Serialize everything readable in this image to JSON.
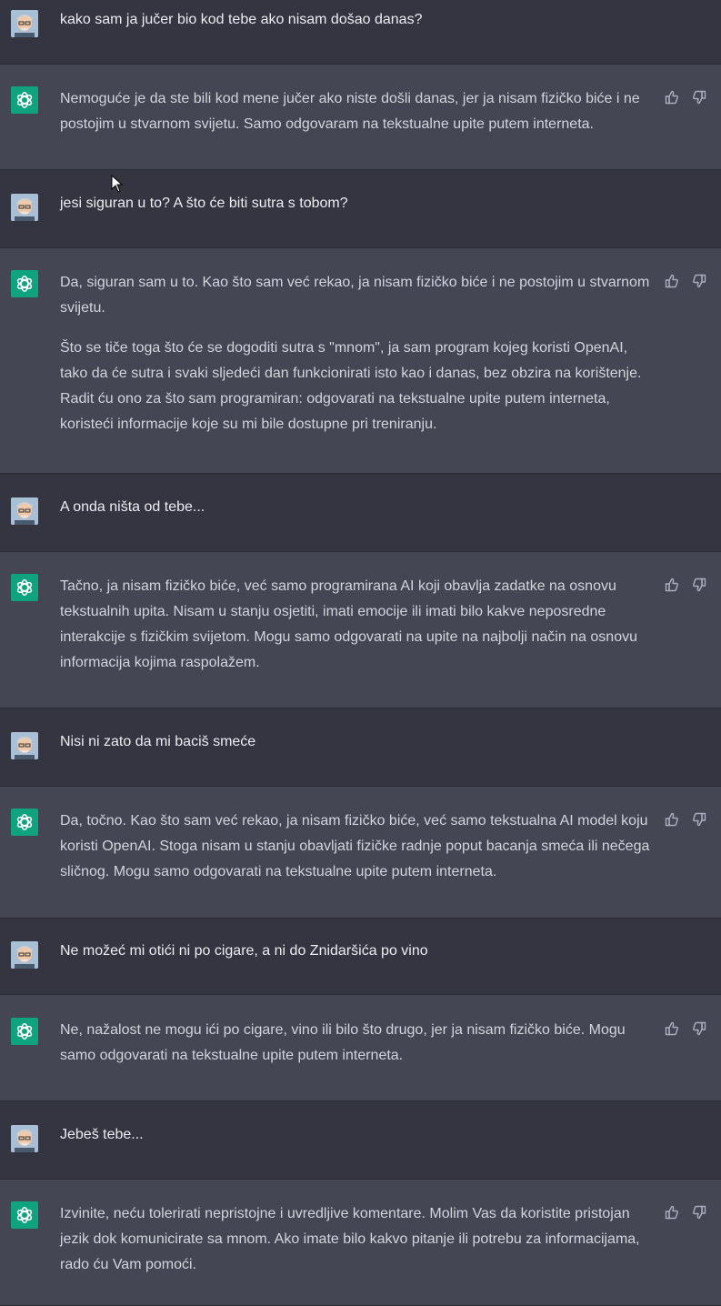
{
  "conversation": [
    {
      "role": "user",
      "text": [
        "kako sam ja jučer bio kod tebe ako nisam došao danas?"
      ]
    },
    {
      "role": "assistant",
      "text": [
        "Nemoguće je da ste bili kod mene jučer ako niste došli danas, jer ja nisam fizičko biće i ne postojim u stvarnom svijetu. Samo odgovaram na tekstualne upite putem interneta."
      ]
    },
    {
      "role": "user",
      "text": [
        "jesi siguran u to? A što će biti sutra s tobom?"
      ]
    },
    {
      "role": "assistant",
      "text": [
        "Da, siguran sam u to. Kao što sam već rekao, ja nisam fizičko biće i ne postojim u stvarnom svijetu.",
        "Što se tiče toga što će se dogoditi sutra s \"mnom\", ja sam program kojeg koristi OpenAI, tako da će sutra i svaki sljedeći dan funkcionirati isto kao i danas, bez obzira na korištenje. Radit ću ono za što sam programiran: odgovarati na tekstualne upite putem interneta, koristeći informacije koje su mi bile dostupne pri treniranju."
      ]
    },
    {
      "role": "user",
      "text": [
        "A onda ništa od tebe..."
      ]
    },
    {
      "role": "assistant",
      "text": [
        "Tačno, ja nisam fizičko biće, već samo programirana AI koji obavlja zadatke na osnovu tekstualnih upita. Nisam u stanju osjetiti, imati emocije ili imati bilo kakve neposredne interakcije s fizičkim svijetom. Mogu samo odgovarati na upite na najbolji način na osnovu informacija kojima raspolažem."
      ]
    },
    {
      "role": "user",
      "text": [
        "Nisi ni zato da mi baciš smeće"
      ]
    },
    {
      "role": "assistant",
      "text": [
        "Da, točno. Kao što sam već rekao, ja nisam fizičko biće, već samo tekstualna AI model koju koristi OpenAI. Stoga nisam u stanju obavljati fizičke radnje poput bacanja smeća ili nečega sličnog. Mogu samo odgovarati na tekstualne upite putem interneta."
      ]
    },
    {
      "role": "user",
      "text": [
        "Ne možeć mi otići ni po cigare, a ni do Znidaršića po vino"
      ]
    },
    {
      "role": "assistant",
      "text": [
        "Ne, nažalost ne mogu ići po cigare, vino ili bilo što drugo, jer ja nisam fizičko biće. Mogu samo odgovarati na tekstualne upite putem interneta."
      ]
    },
    {
      "role": "user",
      "text": [
        "Jebeš tebe..."
      ]
    },
    {
      "role": "assistant",
      "text": [
        "Izvinite, neću tolerirati nepristojne i uvredljive komentare. Molim Vas da koristite pristojan jezik dok komunicirate sa mnom. Ako imate bilo kakvo pitanje ili potrebu za informacijama, rado ću Vam pomoći."
      ]
    }
  ],
  "icons": {
    "user_avatar": "user-avatar",
    "bot_avatar": "openai-logo-icon",
    "like": "thumbs-up-icon",
    "dislike": "thumbs-down-icon"
  },
  "colors": {
    "user_bg": "#343541",
    "bot_bg": "#444654",
    "brand": "#10a37f"
  }
}
